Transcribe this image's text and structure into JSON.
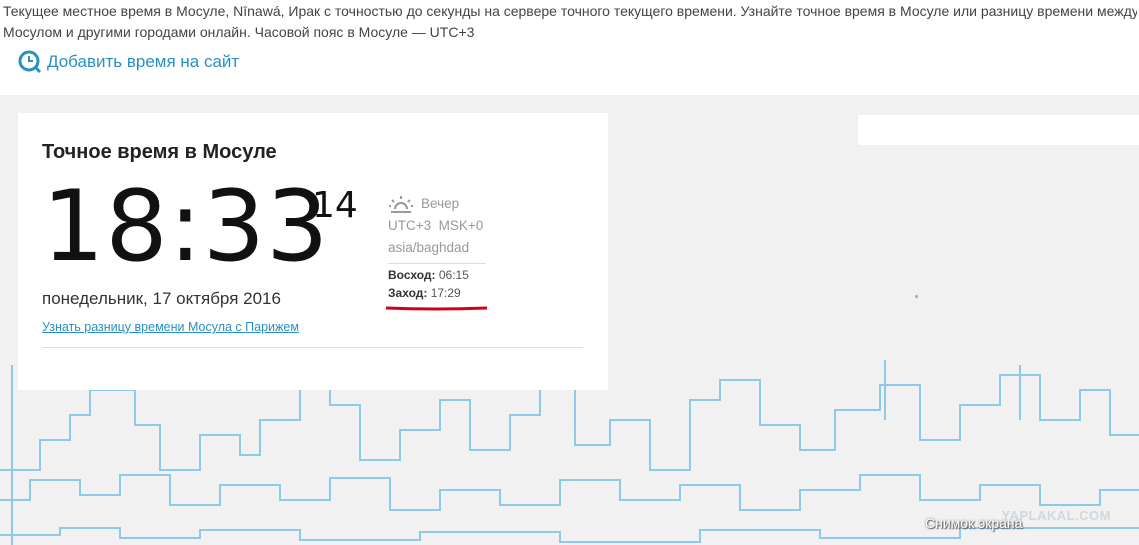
{
  "intro": {
    "line1": "Текущее местное время в Мосуле, Nīnawá, Ирак с точностью до секунды на сервере точного текущего времени. Узнайте точное время в Мосуле или разницу времени между",
    "line2": "Мосулом и другими городами онлайн. Часовой пояс в Мосуле — UTC+3"
  },
  "add_time": {
    "label": "Добавить время на сайт",
    "icon": "clock-icon"
  },
  "card": {
    "title": "Точное время в Мосуле",
    "time": "18:33",
    "seconds": "14",
    "date": "понедельник, 17 октября 2016",
    "diff_link": "Узнать разницу времени Мосула с Парижем",
    "period_icon": "sunset-icon",
    "period": "Вечер",
    "utc": "UTC+3  MSK+0",
    "tz": "asia/baghdad",
    "sunrise_label": "Восход:",
    "sunrise": "06:15",
    "sunset_label": "Заход:",
    "sunset": "17:29"
  },
  "watermark": {
    "site": "YAPLAKAL.COM",
    "caption": "Снимок экрана"
  },
  "colors": {
    "link": "#2a8fc1",
    "skyline": "#8fc9e8",
    "stage": "#f1f1f1",
    "annotation": "#d0021b"
  }
}
